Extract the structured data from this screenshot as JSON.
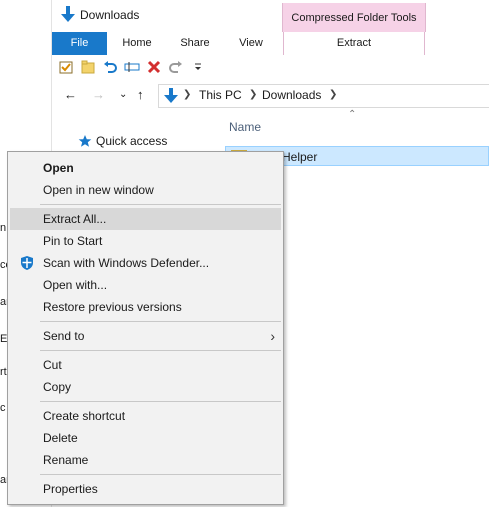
{
  "window": {
    "title": "Downloads"
  },
  "ribbon": {
    "context_header": "Compressed Folder Tools",
    "tabs": {
      "file": "File",
      "home": "Home",
      "share": "Share",
      "view": "View",
      "extract": "Extract"
    }
  },
  "address": {
    "crumbs": [
      "This PC",
      "Downloads"
    ]
  },
  "nav": {
    "quick_access": "Quick access"
  },
  "file_list": {
    "column_name": "Name",
    "selected_file": "Helper"
  },
  "context_menu": {
    "open": "Open",
    "open_new_window": "Open in new window",
    "extract_all": "Extract All...",
    "pin_to_start": "Pin to Start",
    "scan_defender": "Scan with Windows Defender...",
    "open_with": "Open with...",
    "restore_versions": "Restore previous versions",
    "send_to": "Send to",
    "cut": "Cut",
    "copy": "Copy",
    "create_shortcut": "Create shortcut",
    "delete": "Delete",
    "rename": "Rename",
    "properties": "Properties"
  },
  "colors": {
    "accent": "#1979ca",
    "context_tab": "#f6d2e7",
    "selection": "#cce8ff",
    "menu_bg": "#f2f2f2",
    "menu_hover": "#d8d8d8"
  }
}
